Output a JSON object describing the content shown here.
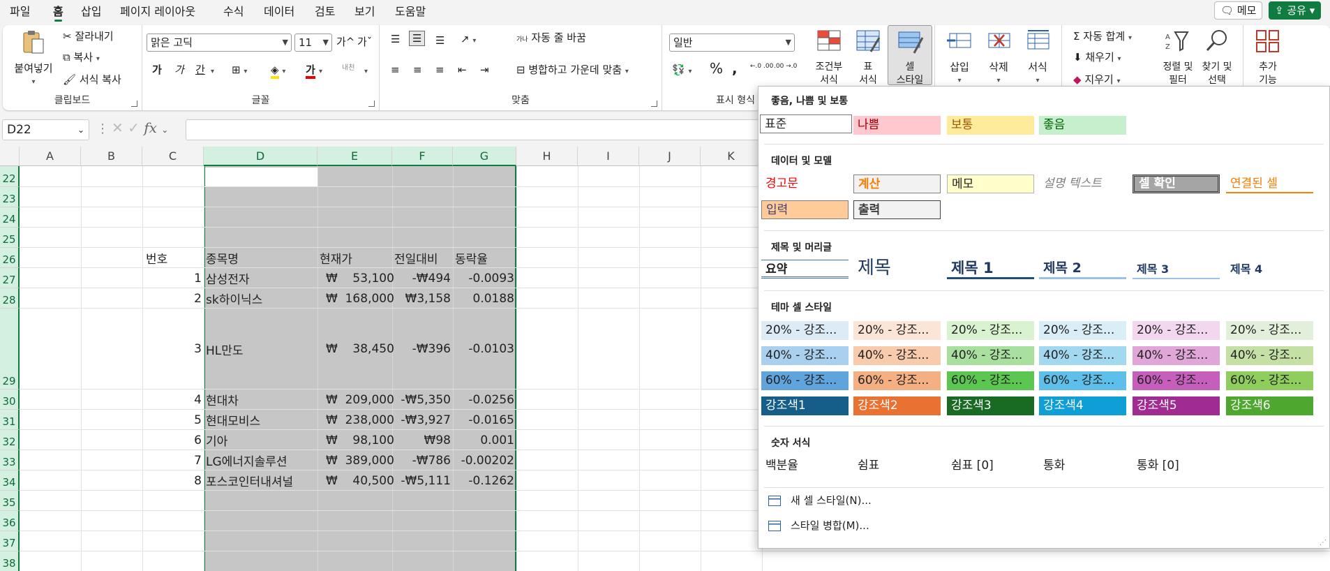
{
  "tabs": [
    "파일",
    "홈",
    "삽입",
    "페이지 레이아웃",
    "수식",
    "데이터",
    "검토",
    "보기",
    "도움말"
  ],
  "header_buttons": {
    "memo": "메모",
    "share": "공유"
  },
  "ribbon": {
    "clipboard": {
      "paste": "붙여넣기",
      "cut": "잘라내기",
      "copy": "복사",
      "format_painter": "서식 복사",
      "group": "클립보드"
    },
    "font": {
      "name": "맑은 고딕",
      "size": "11",
      "grow": "가^",
      "shrink": "가ˇ",
      "bold": "가",
      "italic": "가",
      "underline": "간",
      "color_letter": "가",
      "phonetic": "내천",
      "group": "글꼴"
    },
    "alignment": {
      "wrap": "자동 줄 바꿈",
      "merge": "병합하고 가운데 맞춤",
      "group": "맞춤",
      "wrap_icon": "가나"
    },
    "number": {
      "format": "일반",
      "percent": "%",
      "comma": ",",
      "inc": "←.0 .00",
      "dec": ".00 →.0",
      "group": "표시 형식"
    },
    "styles": {
      "conditional": "조건부\n서식",
      "table": "표\n서식",
      "cell": "셀\n스타일"
    },
    "cells": {
      "insert": "삽입",
      "delete": "삭제",
      "format": "서식"
    },
    "editing": {
      "autosum": "자동 합계",
      "fill": "채우기",
      "clear": "지우기",
      "sort": "정렬 및\n필터",
      "find": "찾기 및\n선택"
    },
    "addins": {
      "label": "추가\n기능"
    }
  },
  "formula_bar": {
    "name_box": "D22",
    "fx": "fx",
    "value": ""
  },
  "columns": [
    "A",
    "B",
    "C",
    "D",
    "E",
    "F",
    "G",
    "H",
    "I",
    "J",
    "K"
  ],
  "rows": [
    "22",
    "23",
    "24",
    "25",
    "26",
    "27",
    "28",
    "29",
    "30",
    "31",
    "32",
    "33",
    "34",
    "35",
    "36",
    "37",
    "38"
  ],
  "table": {
    "headers": [
      "번호",
      "종목명",
      "현재가",
      "전일대비",
      "동락율"
    ],
    "data": [
      [
        "1",
        "삼성전자",
        "₩    53,100",
        "-₩494",
        "-0.0093"
      ],
      [
        "2",
        "sk하이닉스",
        "₩  168,000",
        "₩3,158",
        "0.0188"
      ],
      [
        "3",
        "HL만도",
        "₩    38,450",
        "-₩396",
        "-0.0103"
      ],
      [
        "4",
        "현대차",
        "₩  209,000",
        "-₩5,350",
        "-0.0256"
      ],
      [
        "5",
        "현대모비스",
        "₩  238,000",
        "-₩3,927",
        "-0.0165"
      ],
      [
        "6",
        "기아",
        "₩    98,100",
        "₩98",
        "0.001"
      ],
      [
        "7",
        "LG에너지솔루션",
        "₩  389,000",
        "-₩786",
        "-0.00202"
      ],
      [
        "8",
        "포스코인터내셔널",
        "₩    40,500",
        "-₩5,111",
        "-0.1262"
      ]
    ]
  },
  "cell_styles": {
    "section1": {
      "title": "좋음, 나쁨 및 보통",
      "items": [
        "표준",
        "나쁨",
        "보통",
        "좋음"
      ]
    },
    "section2": {
      "title": "데이터 및 모델",
      "items": [
        "경고문",
        "계산",
        "메모",
        "설명 텍스트",
        "셀 확인",
        "연결된 셀",
        "입력",
        "출력"
      ]
    },
    "section3": {
      "title": "제목 및 머리글",
      "items": [
        "요약",
        "제목",
        "제목 1",
        "제목 2",
        "제목 3",
        "제목 4"
      ]
    },
    "section4": {
      "title": "테마 셀 스타일",
      "row20": "20% - 강조...",
      "row40": "40% - 강조...",
      "row60": "60% - 강조...",
      "accents": [
        "강조색1",
        "강조색2",
        "강조색3",
        "강조색4",
        "강조색5",
        "강조색6"
      ]
    },
    "section5": {
      "title": "숫자 서식",
      "items": [
        "백분율",
        "쉼표",
        "쉼표 [0]",
        "통화",
        "통화 [0]"
      ]
    },
    "menu": {
      "new_style": "새 셀 스타일(N)...",
      "merge_styles": "스타일 병합(M)..."
    }
  },
  "colors": {
    "accent": "#107c41",
    "selection": "#c6c6c6"
  }
}
